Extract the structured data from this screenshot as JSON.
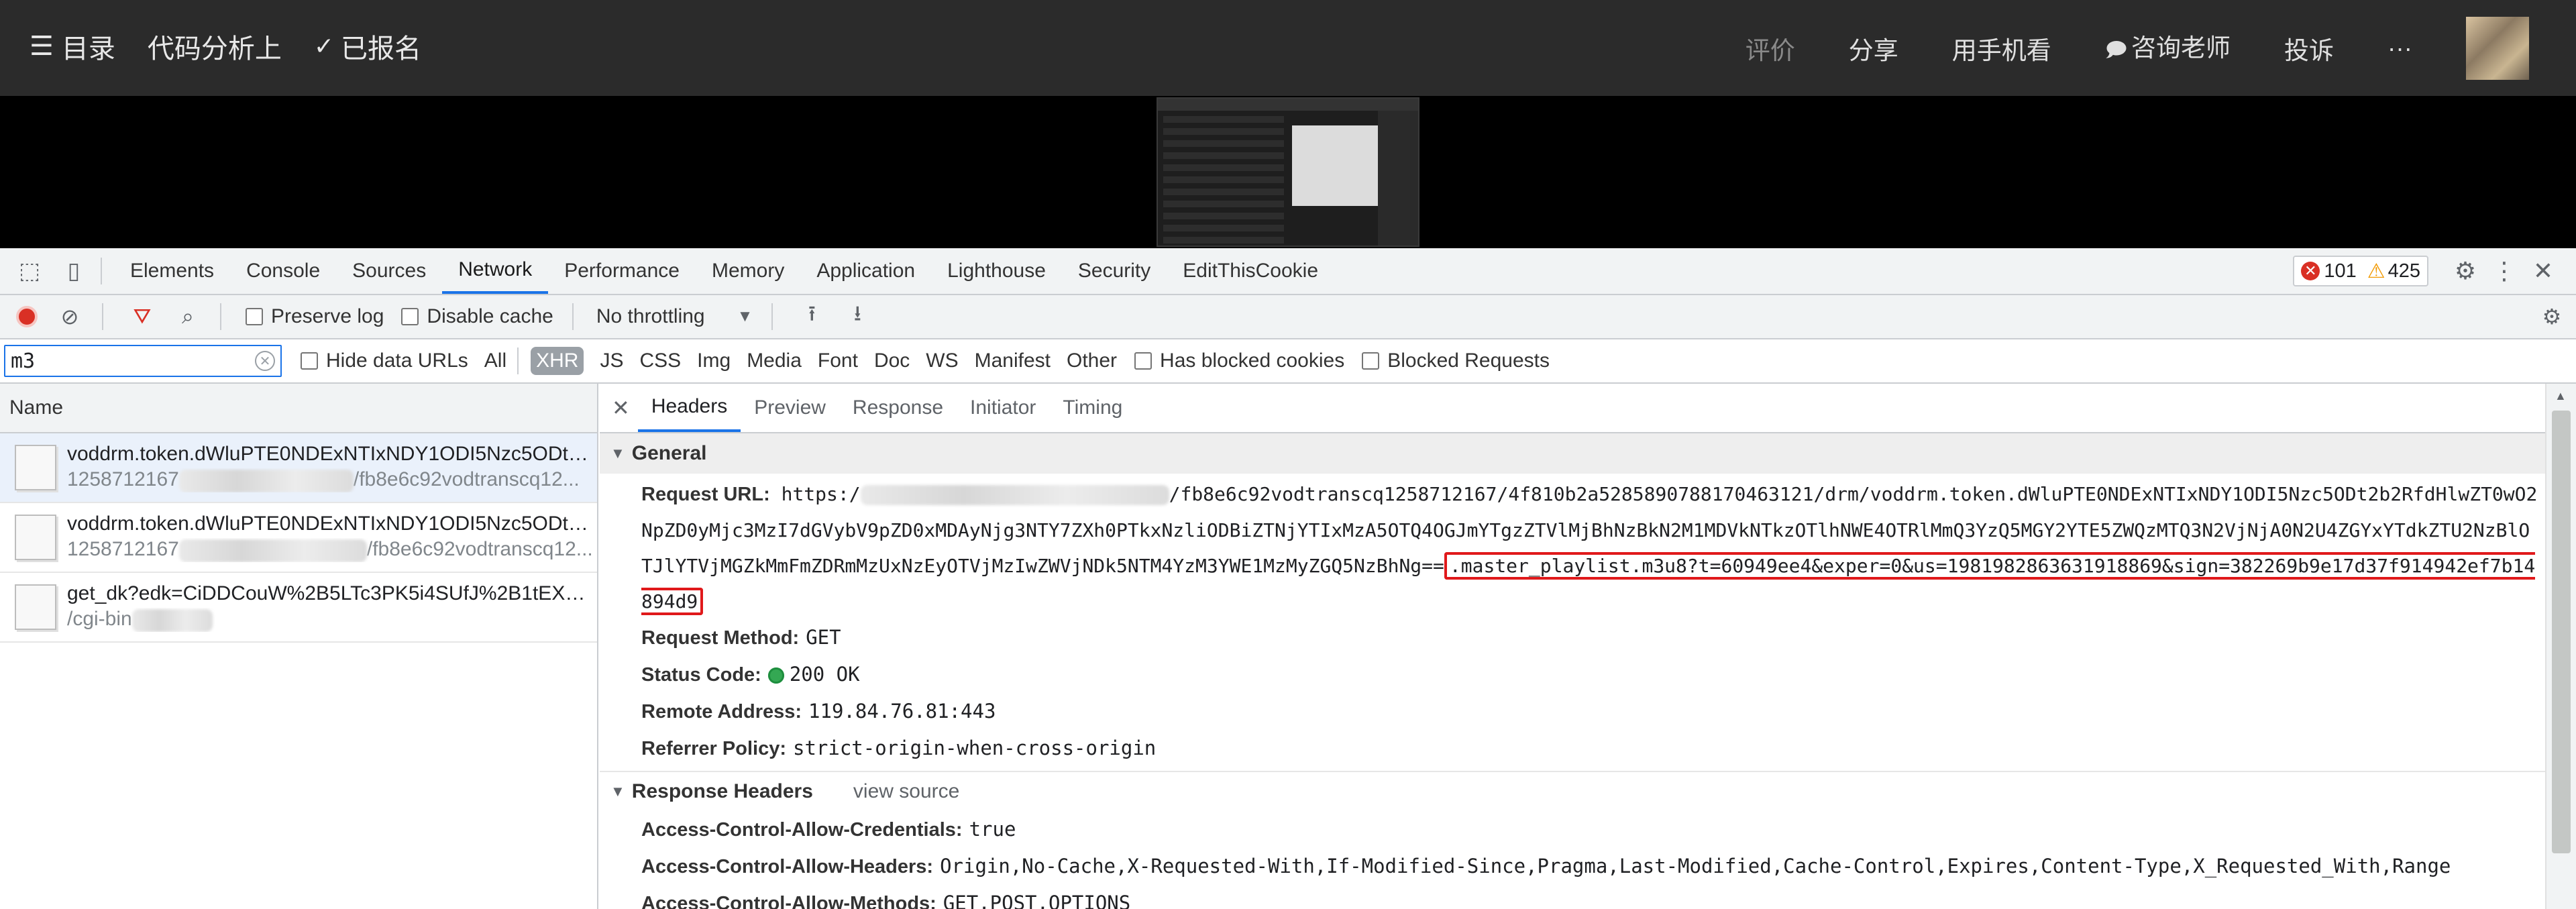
{
  "course_bar": {
    "menu_label": "目录",
    "course_title": "代码分析上",
    "enrolled_label": "已报名",
    "right_items": [
      "评价",
      "分享",
      "用手机看",
      "咨询老师",
      "投诉",
      "···"
    ]
  },
  "devtools": {
    "panel_tabs": [
      "Elements",
      "Console",
      "Sources",
      "Network",
      "Performance",
      "Memory",
      "Application",
      "Lighthouse",
      "Security",
      "EditThisCookie"
    ],
    "active_tab": "Network",
    "error_count": "101",
    "warning_count": "425",
    "toolbar": {
      "preserve_log": "Preserve log",
      "disable_cache": "Disable cache",
      "throttling": "No throttling"
    },
    "filter": {
      "value": "m3",
      "hide_data_urls": "Hide data URLs",
      "types": [
        "All",
        "XHR",
        "JS",
        "CSS",
        "Img",
        "Media",
        "Font",
        "Doc",
        "WS",
        "Manifest",
        "Other"
      ],
      "selected_type": "XHR",
      "has_blocked_cookies": "Has blocked cookies",
      "blocked_requests": "Blocked Requests"
    },
    "requests": {
      "header": "Name",
      "items": [
        {
          "name": "voddrm.token.dWluPTE0NDExNTIxNDY1ODI5Nzc5ODt2b...",
          "path_start": "1258712167",
          "path_end": "/fb8e6c92vodtranscq12..."
        },
        {
          "name": "voddrm.token.dWluPTE0NDExNTIxNDY1ODI5Nzc5ODt2b...",
          "path_start": "1258712167",
          "path_end": "/fb8e6c92vodtranscq12..."
        },
        {
          "name": "get_dk?edk=CiDDCouW%2B5LTc3PK5i4SUfJ%2B1tEX%2B...",
          "path_start": "/cgi-bin",
          "path_end": ""
        }
      ]
    },
    "detail_tabs": [
      "Headers",
      "Preview",
      "Response",
      "Initiator",
      "Timing"
    ],
    "active_detail_tab": "Headers",
    "general": {
      "title": "General",
      "request_url_label": "Request URL:",
      "request_url_prefix": "https:/",
      "request_url_body": "/fb8e6c92vodtranscq1258712167/4f810b2a5285890788170463121/drm/voddrm.token.dWluPTE0NDExNTIxNDY1ODI5Nzc5ODt2b2RfdHlwZT0wO2NpZD0yMjc3MzI7dGVybV9pZD0xMDAyNjg3NTY7ZXh0PTkxNzliODBiZTNjYTIxMzA5OTQ4OGJmYTgzZTVlMjBhNzBkN2M1MDVkNTkzOTlhNWE4OTRlMmQ3YzQ5MGY2YTE5ZWQzMTQ3N2VjNjA0N2U4ZGYxYTdkZTU2NzBlOTJlYTVjMGZkMmFmZDRmMzUxNzEyOTVjMzIwZWVjNDk5NTM4YzM3YWE1MzMyZGQ5NzBhNg==",
      "request_url_highlight": ".master_playlist.m3u8?t=60949ee4&exper=0&us=1981982863631918869&sign=382269b9e17d37f914942ef7b14894d9",
      "request_method_label": "Request Method:",
      "request_method": "GET",
      "status_code_label": "Status Code:",
      "status_code": "200 OK",
      "remote_address_label": "Remote Address:",
      "remote_address": "119.84.76.81:443",
      "referrer_policy_label": "Referrer Policy:",
      "referrer_policy": "strict-origin-when-cross-origin"
    },
    "response_headers": {
      "title": "Response Headers",
      "view_source": "view source",
      "items": [
        {
          "k": "Access-Control-Allow-Credentials:",
          "v": "true"
        },
        {
          "k": "Access-Control-Allow-Headers:",
          "v": "Origin,No-Cache,X-Requested-With,If-Modified-Since,Pragma,Last-Modified,Cache-Control,Expires,Content-Type,X_Requested_With,Range"
        },
        {
          "k": "Access-Control-Allow-Methods:",
          "v": "GET,POST,OPTIONS"
        }
      ]
    },
    "colors": {
      "accent": "#1a73e8",
      "record": "#d93025",
      "highlight_box": "#e0191b",
      "status_ok": "#34a853"
    }
  }
}
